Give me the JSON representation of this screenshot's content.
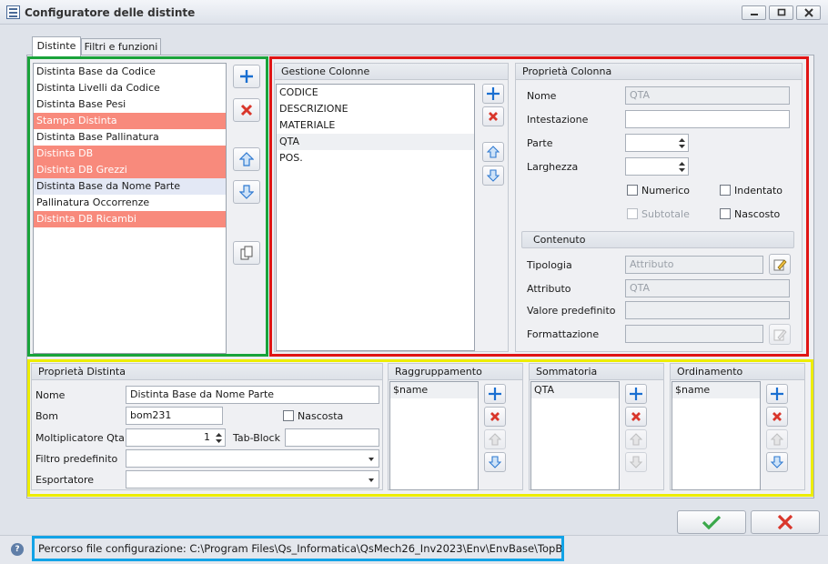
{
  "window": {
    "title": "Configuratore delle distinte"
  },
  "tabs": [
    {
      "label": "Distinte",
      "active": true
    },
    {
      "label": "Filtri e funzioni",
      "active": false
    }
  ],
  "distinte": {
    "items": [
      {
        "label": "Distinta Base da Codice",
        "state": "normal"
      },
      {
        "label": "Distinta Livelli da Codice",
        "state": "normal"
      },
      {
        "label": "Distinta Base Pesi",
        "state": "normal"
      },
      {
        "label": "Stampa Distinta",
        "state": "highlight"
      },
      {
        "label": "Distinta Base Pallinatura",
        "state": "normal"
      },
      {
        "label": "Distinta DB",
        "state": "highlight"
      },
      {
        "label": "Distinta DB Grezzi",
        "state": "highlight"
      },
      {
        "label": "Distinta Base da Nome Parte",
        "state": "selected"
      },
      {
        "label": "Pallinatura Occorrenze",
        "state": "normal"
      },
      {
        "label": "Distinta DB Ricambi",
        "state": "highlight"
      }
    ]
  },
  "gestione_colonne": {
    "title": "Gestione Colonne",
    "items": [
      "CODICE",
      "DESCRIZIONE",
      "MATERIALE",
      "QTA",
      "POS."
    ],
    "selected_index": 3
  },
  "proprieta_colonna": {
    "title": "Proprietà Colonna",
    "nome_label": "Nome",
    "nome_value": "QTA",
    "intestazione_label": "Intestazione",
    "intestazione_value": "",
    "parte_label": "Parte",
    "larghezza_label": "Larghezza",
    "numerico_label": "Numerico",
    "indentato_label": "Indentato",
    "subtotale_label": "Subtotale",
    "nascosto_label": "Nascosto",
    "contenuto_title": "Contenuto",
    "tipologia_label": "Tipologia",
    "tipologia_value": "Attributo",
    "attributo_label": "Attributo",
    "attributo_value": "QTA",
    "valore_label": "Valore predefinito",
    "valore_value": "",
    "formattazione_label": "Formattazione",
    "formattazione_value": ""
  },
  "proprieta_distinta": {
    "title": "Proprietà Distinta",
    "nome_label": "Nome",
    "nome_value": "Distinta Base da Nome Parte",
    "bom_label": "Bom",
    "bom_value": "bom231",
    "nascosta_label": "Nascosta",
    "molt_label": "Moltiplicatore Qta",
    "molt_value": "1",
    "tabblock_label": "Tab-Block",
    "tabblock_value": "",
    "filtro_label": "Filtro predefinito",
    "filtro_value": "",
    "esportatore_label": "Esportatore",
    "esportatore_value": ""
  },
  "raggruppamento": {
    "title": "Raggruppamento",
    "items": [
      "$name"
    ]
  },
  "sommatoria": {
    "title": "Sommatoria",
    "items": [
      "QTA"
    ]
  },
  "ordinamento": {
    "title": "Ordinamento",
    "items": [
      "$name"
    ]
  },
  "status": {
    "text": "Percorso file configurazione: C:\\Program Files\\Qs_Informatica\\QsMech26_Inv2023\\Env\\EnvBase\\TopBom.ini"
  },
  "colors": {
    "highlight_row": "#f88a7c",
    "green_frame": "#1aa33a",
    "red_frame": "#e01414",
    "yellow_frame": "#eded00",
    "blue_frame": "#12a3e6",
    "add": "#1a6fd1",
    "remove": "#d9362b"
  }
}
